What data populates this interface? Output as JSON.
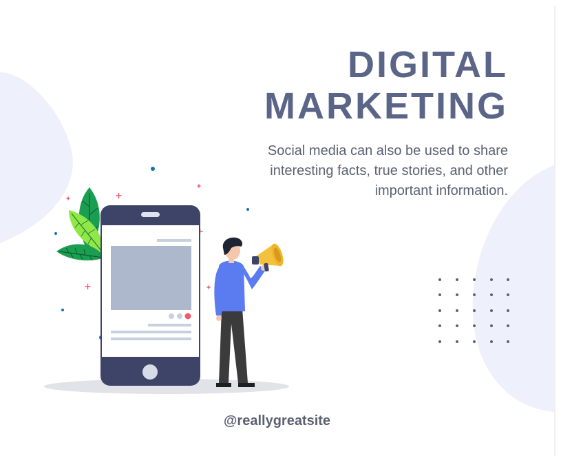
{
  "header": {
    "title_line1": "DIGITAL",
    "title_line2": "MARKETING",
    "cropped_heading_partial": ""
  },
  "body": {
    "description": "Social media can also be used to share interesting facts, true stories, and other important information."
  },
  "footer": {
    "handle": "@reallygreatsite"
  },
  "colors": {
    "title": "#5a6587",
    "body_text": "#5c6274",
    "blob": "#eef0fb",
    "phone_frame": "#3d4468",
    "leaf_dark": "#1a9e52",
    "leaf_light": "#8fe84a",
    "shirt": "#5b7bf0",
    "megaphone": "#f3c13b",
    "accent_red": "#ef5a6a"
  },
  "icons": [
    "phone-icon",
    "megaphone-icon",
    "leaf-icon",
    "person-icon",
    "dot-grid-icon"
  ]
}
